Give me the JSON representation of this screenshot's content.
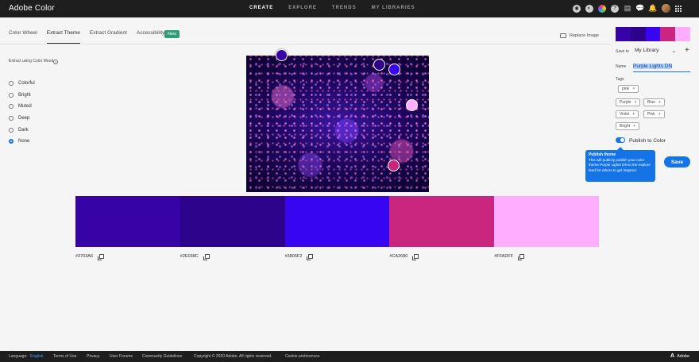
{
  "app": {
    "title": "Adobe Color"
  },
  "nav": [
    "CREATE",
    "EXPLORE",
    "TRENDS",
    "MY LIBRARIES"
  ],
  "tabs": {
    "items": [
      "Color Wheel",
      "Extract Theme",
      "Extract Gradient",
      "Accessibility Tools"
    ],
    "new_badge": "New"
  },
  "replace_image": "Replace Image",
  "mood": {
    "label": "Extract using Color Mood",
    "help": "?",
    "options": [
      "Colorful",
      "Bright",
      "Muted",
      "Deep",
      "Dark",
      "None"
    ],
    "selected": "None"
  },
  "swatches": [
    {
      "hex": "#3703A6",
      "color": "#3703A6"
    },
    {
      "hex": "#2E038C",
      "color": "#2E038C"
    },
    {
      "hex": "#3805F2",
      "color": "#3805F2"
    },
    {
      "hex": "#CA2680",
      "color": "#CA2680"
    },
    {
      "hex": "#FFADFF",
      "color": "#FFADFF"
    }
  ],
  "panel": {
    "save_to_label": "Save to",
    "library": "My Library",
    "name_label": "Name",
    "name_value": "Purple Lights DN",
    "tags_label": "Tags",
    "applied_tag": "pink",
    "suggested_tags": [
      "Purple",
      "Blue",
      "Violet",
      "Pink",
      "Bright"
    ],
    "publish_label": "Publish to Color",
    "tooltip_title": "Publish theme",
    "tooltip_body": "This will publicly publish your color theme Purple Lights DN to the explore feed for others to get inspired.",
    "save": "Save"
  },
  "footer": {
    "language_label": "Language:",
    "language_value": "English",
    "links": [
      "Terms of Use",
      "Privacy",
      "User Forums",
      "Community Guidelines",
      "Copyright © 2020 Adobe. All rights reserved.",
      "Cookie preferences"
    ],
    "brand": "Adobe"
  }
}
